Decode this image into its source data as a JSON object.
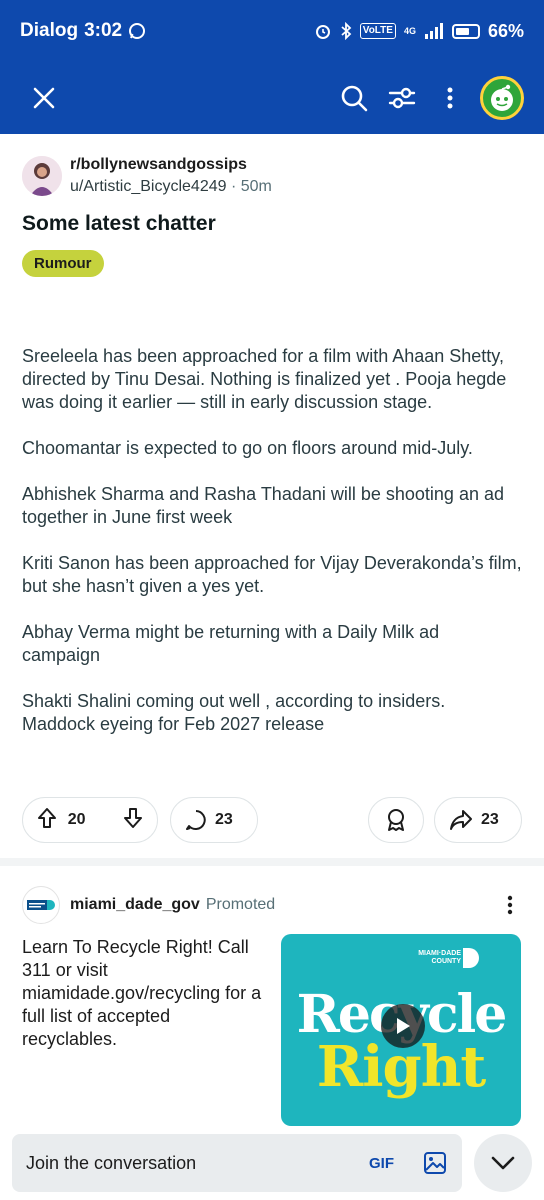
{
  "status_bar": {
    "carrier": "Dialog",
    "time": "3:02",
    "volte": "VoLTE",
    "network": "4G",
    "battery": "66%",
    "battery_level": 0.66
  },
  "app_bar": {
    "close_icon": "close-icon",
    "search_icon": "search-icon",
    "filter_icon": "sliders-icon",
    "more_icon": "more-vertical-icon",
    "avatar_icon": "snoo-avatar"
  },
  "post": {
    "subreddit": "r/bollynewsandgossips",
    "user": "u/Artistic_Bicycle4249",
    "separator": "·",
    "age": "50m",
    "title": "Some latest chatter",
    "flair": "Rumour",
    "paragraphs": [
      "Sreeleela has been approached for a film with Ahaan Shetty, directed by Tinu Desai. Nothing is finalized yet . Pooja hegde was doing it earlier — still in early discussion stage.",
      "Choomantar is expected to go on floors around mid-July.",
      "Abhishek Sharma and Rasha Thadani will be shooting an ad together in June first week",
      "Kriti Sanon has been approached for Vijay Deverakonda’s film, but she hasn’t given a yes yet.",
      "Abhay Verma might be returning with a Daily Milk ad campaign",
      "Shakti Shalini coming out well , according to insiders. Maddock eyeing for Feb 2027 release"
    ],
    "actions": {
      "upvotes": "20",
      "comments": "23",
      "shares": "23"
    }
  },
  "ad": {
    "advertiser": "miami_dade_gov",
    "label": "Promoted",
    "text": "Learn To Recycle Right! Call 311 or visit miamidade.gov/recycling for a full list of accepted recyclables.",
    "image_line1": "Recycle",
    "image_line2": "Right",
    "image_badge_line1": "MIAMI·DADE",
    "image_badge_line2": "COUNTY"
  },
  "bottom_bar": {
    "placeholder": "Join the conversation",
    "gif": "GIF"
  },
  "colors": {
    "brand_blue": "#0e49ad",
    "flair_bg": "#c5d23d",
    "ad_teal": "#1eb5be",
    "ad_yellow": "#f1e52a"
  }
}
